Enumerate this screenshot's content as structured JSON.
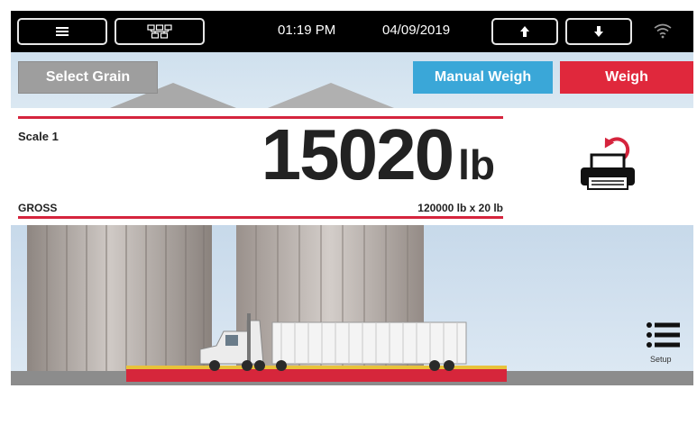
{
  "topbar": {
    "menu_icon": "hamburger-icon",
    "network_icon": "network-tree-icon",
    "time": "01:19 PM",
    "date": "04/09/2019",
    "up_icon": "arrow-up-icon",
    "down_icon": "arrow-down-icon",
    "wifi_icon": "wifi-icon"
  },
  "actions": {
    "select_grain": "Select Grain",
    "manual_weigh": "Manual Weigh",
    "weigh": "Weigh"
  },
  "readout": {
    "scale_name": "Scale 1",
    "weight_value": "15020",
    "weight_unit": "lb",
    "mode": "GROSS",
    "capacity": "120000 lb x 20 lb"
  },
  "setup": {
    "label": "Setup"
  },
  "colors": {
    "accent_red": "#d5243d",
    "weigh_red": "#e0283c",
    "manual_blue": "#3aa7d8",
    "grain_gray": "#9e9e9e",
    "topbar_black": "#000000"
  }
}
